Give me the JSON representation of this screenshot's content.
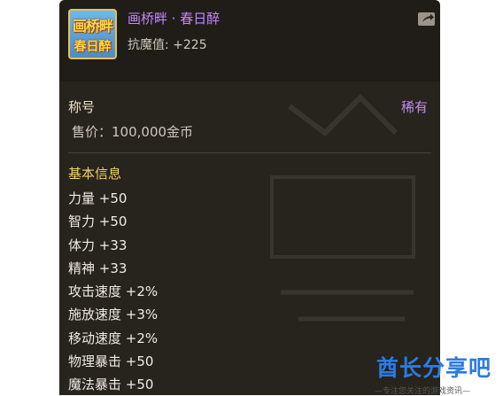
{
  "item": {
    "icon_name": "title-badge-icon",
    "icon_text_line1": "画桥畔",
    "icon_text_line2": "春日醉",
    "name": "画桥畔 · 春日醉",
    "resist": "抗魔值: +225"
  },
  "share_icon": "share-icon",
  "section": {
    "title": "称号",
    "rarity": "稀有",
    "price": "售价：100,000金币"
  },
  "info": {
    "title": "基本信息",
    "stats": [
      "力量 +50",
      "智力 +50",
      "体力 +33",
      "精神 +33",
      "攻击速度 +2%",
      "施放速度 +3%",
      "移动速度 +2%",
      "物理暴击 +50",
      "魔法暴击 +50"
    ]
  },
  "watermark": {
    "title": "酋长分享吧",
    "subtitle": "—专注您关注的游戏资讯—"
  },
  "colors": {
    "panel": "#27231d",
    "rarity_purple": "#c389ff",
    "section_gold": "#f4cf6b",
    "watermark_blue": "#2c7be2"
  }
}
